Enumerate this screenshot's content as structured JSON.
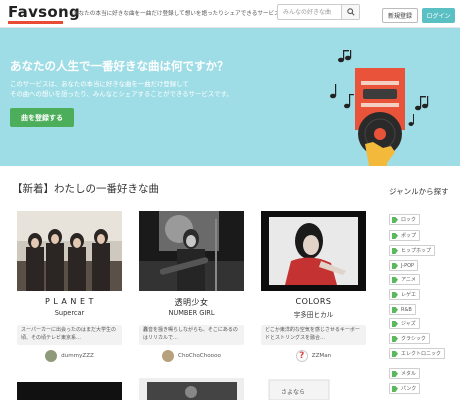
{
  "header": {
    "logo": "Favsong",
    "tagline": "あなたの本当に好きな曲を一曲だけ登録して想いを語ったりシェアできるサービス",
    "search_placeholder": "みんなの好きな曲",
    "register_label": "新規登録",
    "login_label": "ログイン"
  },
  "hero": {
    "title": "あなたの人生で一番好きな曲は何ですか？",
    "desc_line1": "このサービスは、あなたの本当に好きな曲を一曲だけ登録して",
    "desc_line2": "その曲への想いを語ったり、みんなとシェアすることができるサービスです。",
    "cta_label": "曲を登録する"
  },
  "section": {
    "title": "【新着】わたしの一番好きな曲"
  },
  "cards": [
    {
      "title": "P L A N E T",
      "artist": "Supercar",
      "note": "スーパーカーに出会ったのはまだ大学生の頃、その頃テレビ東京系…",
      "user": "dummyZZZ"
    },
    {
      "title": "透明少女",
      "artist": "NUMBER GIRL",
      "note": "轟音を掻き鳴らしながらも、そこにあるのはリリカルで…",
      "user": "ChoChoChoooo"
    },
    {
      "title": "COLORS",
      "artist": "宇多田ヒカル",
      "note": "どこか東洋的な空気を感じさせるキーボードとストリングスを融合…",
      "user": "ZZMan"
    }
  ],
  "row2": {
    "card3_text": "さよなら"
  },
  "sidebar": {
    "title": "ジャンルから探す",
    "tags": [
      "ロック",
      "ポップ",
      "ヒップホップ",
      "J-POP",
      "アニメ",
      "レゲエ",
      "R&B",
      "ジャズ",
      "クラシック",
      "エレクトロニック",
      "メタル",
      "パンク"
    ]
  },
  "colors": {
    "accent": "#e94b35",
    "hero_bg": "#9fdde6",
    "cta": "#4cae5a",
    "login": "#5bc0c3",
    "tag_icon": "#5cb85c"
  }
}
